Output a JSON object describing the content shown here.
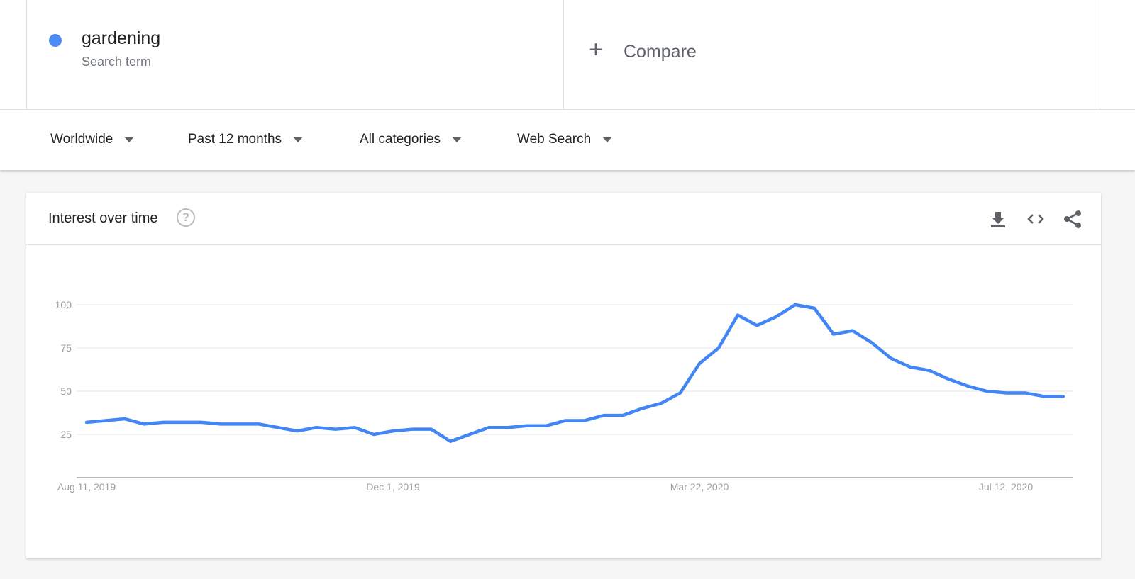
{
  "search_terms": [
    {
      "name": "gardening",
      "subtitle": "Search term",
      "color": "#4c8bf5"
    }
  ],
  "compare": {
    "icon": "plus-icon",
    "label": "Compare"
  },
  "filters": [
    {
      "label": "Worldwide",
      "icon": "caret-down-icon"
    },
    {
      "label": "Past 12 months",
      "icon": "caret-down-icon"
    },
    {
      "label": "All categories",
      "icon": "caret-down-icon"
    },
    {
      "label": "Web Search",
      "icon": "caret-down-icon"
    }
  ],
  "card": {
    "title": "Interest over time",
    "help_icon": "?",
    "actions": [
      "download-icon",
      "embed-code-icon",
      "share-icon"
    ]
  },
  "chart_data": {
    "type": "line",
    "title": "Interest over time",
    "xlabel": "",
    "ylabel": "",
    "ylim": [
      0,
      100
    ],
    "yticks": [
      25,
      50,
      75,
      100
    ],
    "xtick_labels": [
      "Aug 11, 2019",
      "Dec 1, 2019",
      "Mar 22, 2020",
      "Jul 12, 2020"
    ],
    "xtick_indices": [
      0,
      16,
      32,
      48
    ],
    "grid": true,
    "series": [
      {
        "name": "gardening",
        "color": "#4285f4",
        "values": [
          32,
          33,
          34,
          31,
          32,
          32,
          32,
          31,
          31,
          31,
          29,
          27,
          29,
          28,
          29,
          25,
          27,
          28,
          28,
          21,
          25,
          29,
          29,
          30,
          30,
          33,
          33,
          36,
          36,
          40,
          43,
          49,
          66,
          75,
          94,
          88,
          93,
          100,
          98,
          83,
          85,
          78,
          69,
          64,
          62,
          57,
          53,
          50,
          49,
          49,
          47,
          47
        ]
      }
    ]
  }
}
